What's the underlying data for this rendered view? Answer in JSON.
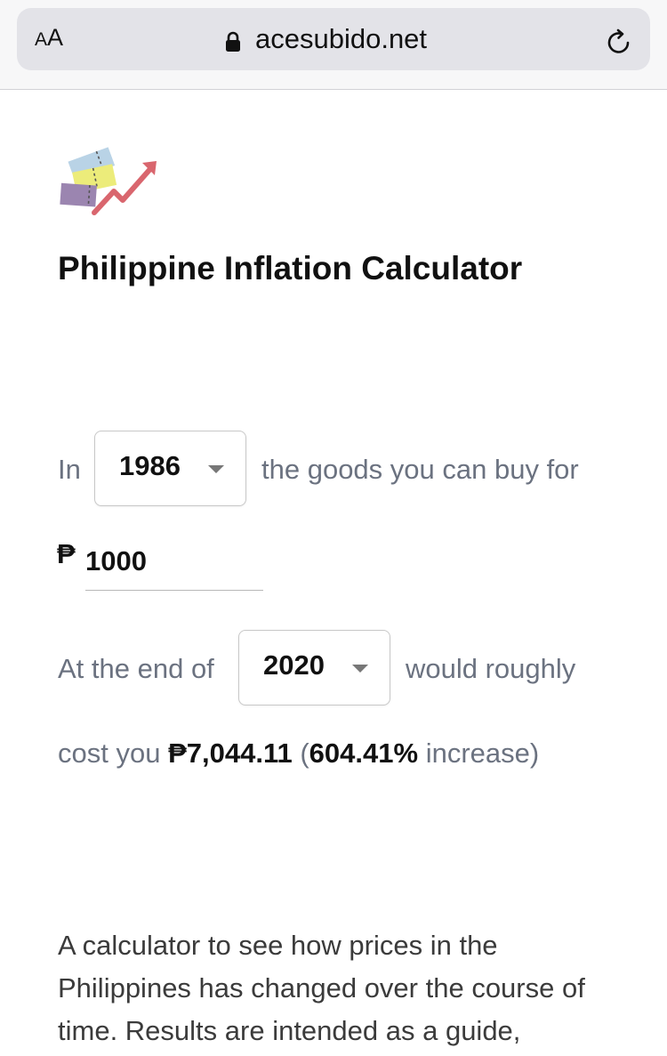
{
  "browser": {
    "aa_label_small": "A",
    "aa_label_large": "A",
    "url": "acesubido.net"
  },
  "page": {
    "title": "Philippine Inflation Calculator"
  },
  "calculator": {
    "in_label": "In",
    "start_year": "1986",
    "goods_text": "the goods you can buy for",
    "currency_symbol": "₱",
    "amount": "1000",
    "end_of_label": "At the end of",
    "end_year": "2020",
    "would_roughly_text": "would roughly",
    "cost_you_text": "cost you",
    "result_amount": "₱7,044.11",
    "paren_open": "(",
    "percent_increase": "604.41%",
    "increase_text": "increase)"
  },
  "description": {
    "text": "A calculator to see how prices in the Philippines has changed over the course of time. Results are intended as a guide,"
  },
  "colors": {
    "text_gray": "#6b7280",
    "text_dark": "#111111",
    "arrow_red": "#d9666e",
    "ticket_blue": "#b9d3e6",
    "ticket_yellow": "#ecec7a",
    "ticket_purple": "#9b85b0"
  }
}
